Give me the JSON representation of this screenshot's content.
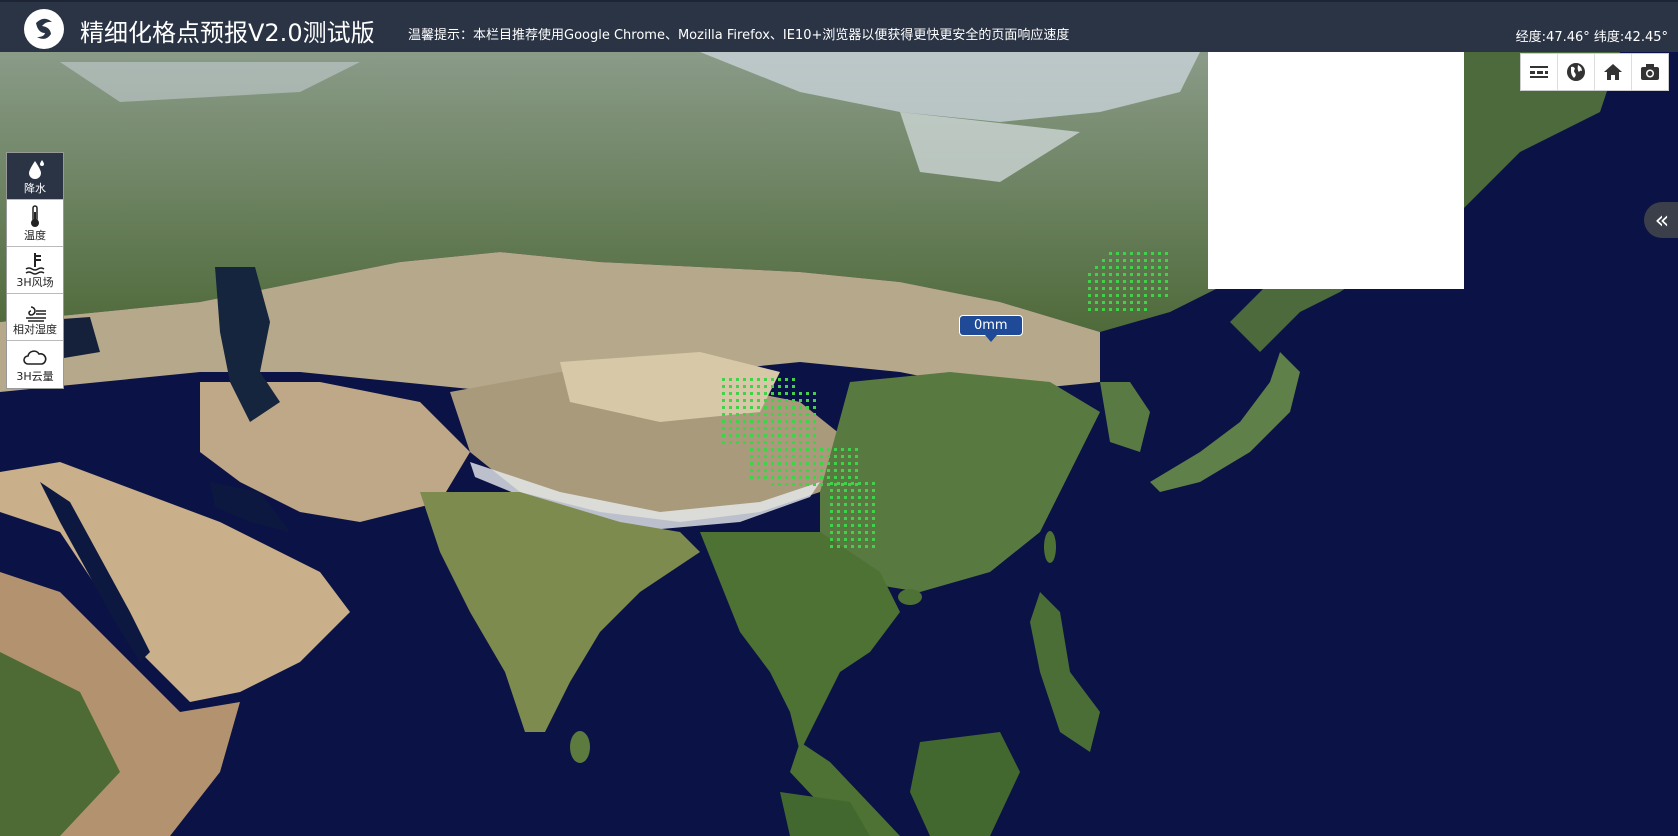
{
  "header": {
    "title": "精细化格点预报V2.0测试版",
    "notice": "温馨提示：本栏目推荐使用Google Chrome、Mozilla Firefox、IE10+浏览器以便获得更快更安全的页面响应速度",
    "coords": "经度:47.46° 纬度:42.45°",
    "logo_icon": "swirl-logo-icon"
  },
  "layers": [
    {
      "label": "降水",
      "icon": "raindrop-icon",
      "active": true
    },
    {
      "label": "温度",
      "icon": "thermometer-icon",
      "active": false
    },
    {
      "label": "3H风场",
      "icon": "wind-icon",
      "active": false
    },
    {
      "label": "相对湿度",
      "icon": "humidity-icon",
      "active": false
    },
    {
      "label": "3H云量",
      "icon": "cloud-icon",
      "active": false
    }
  ],
  "toolbar": {
    "buttons": [
      "legend-icon",
      "globe-icon",
      "home-icon",
      "camera-icon"
    ]
  },
  "collapse": {
    "label": "«"
  },
  "map_badge": {
    "value": "0mm"
  },
  "colors": {
    "header_bg": "#2b3445",
    "ocean": "#0b1245",
    "badge": "#1e4a98",
    "grid_points": "#3fd24a"
  }
}
